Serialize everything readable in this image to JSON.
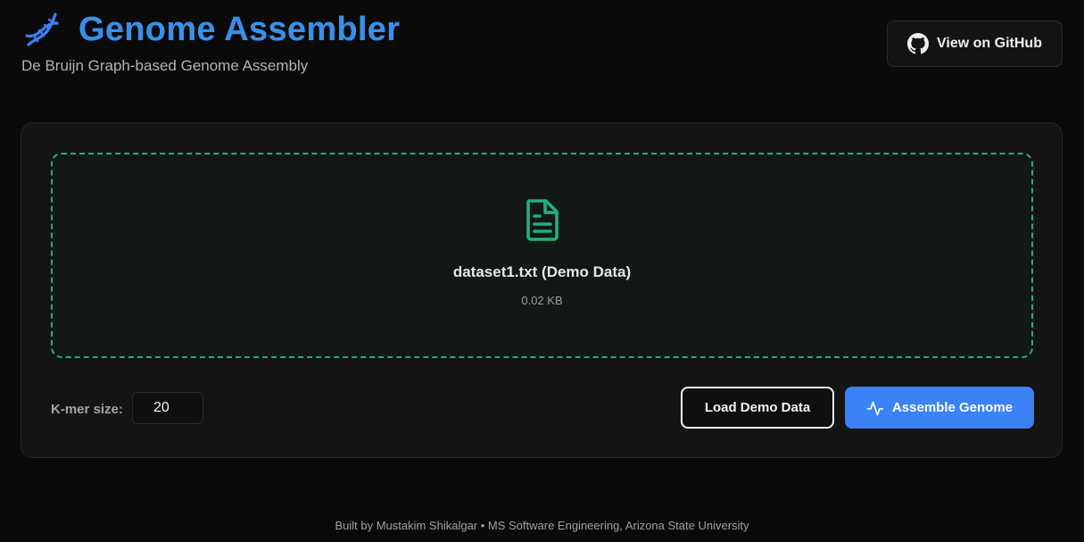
{
  "header": {
    "title": "Genome Assembler",
    "subtitle": "De Bruijn Graph-based Genome Assembly",
    "logo_icon": "dna-icon"
  },
  "github_button": {
    "label": "View on GitHub",
    "icon": "github-icon"
  },
  "dropzone": {
    "icon": "file-text-icon",
    "file_name": "dataset1.txt (Demo Data)",
    "file_size": "0.02 KB"
  },
  "controls": {
    "kmer_label": "K-mer size:",
    "kmer_value": "20",
    "load_demo_label": "Load Demo Data",
    "assemble_label": "Assemble Genome",
    "assemble_icon": "activity-icon"
  },
  "footer": {
    "text": "Built by Mustakim Shikalgar • MS Software Engineering, Arizona State University"
  },
  "colors": {
    "accent_blue": "#3b82f6",
    "accent_green": "#22b07d",
    "background": "#0a0a0a",
    "card": "#141414"
  }
}
